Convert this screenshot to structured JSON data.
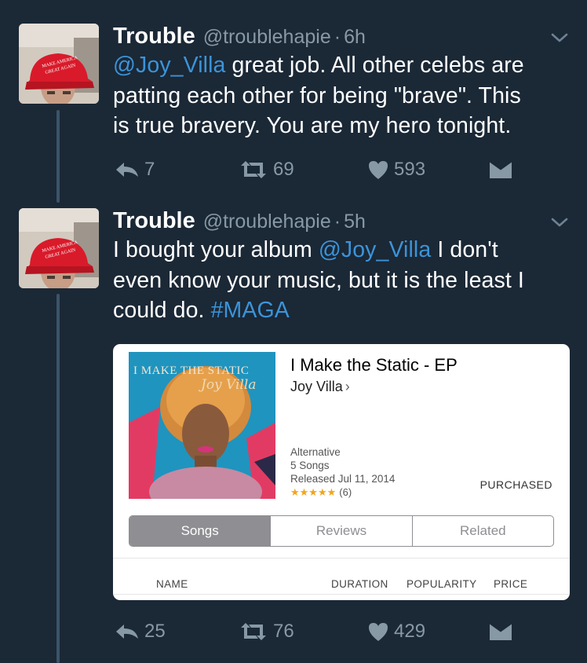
{
  "tweets": [
    {
      "name": "Trouble",
      "handle": "@troublehapie",
      "separator": "·",
      "time": "6h",
      "text_parts": {
        "mention": "@Joy_Villa",
        "line1_rest": " great job. All other celebs are",
        "line2": "patting each other for being \"brave\". This",
        "line3": "is true bravery. You are my hero tonight."
      },
      "replies": "7",
      "retweets": "69",
      "likes": "593"
    },
    {
      "name": "Trouble",
      "handle": "@troublehapie",
      "separator": "·",
      "time": "5h",
      "text_parts": {
        "line1_start": "I bought your album ",
        "mention": "@Joy_Villa",
        "line1_end": " I don't",
        "line2": "even know your music, but it is the least I",
        "line3_start": "could do. ",
        "hashtag": "#MAGA"
      },
      "replies": "25",
      "retweets": "76",
      "likes": "429"
    }
  ],
  "card": {
    "art_title": "I MAKE THE STATIC",
    "art_script": "Joy Villa",
    "album_title": "I Make the Static - EP",
    "artist": "Joy Villa",
    "artist_chevron": "›",
    "genre": "Alternative",
    "song_count": "5 Songs",
    "released": "Released Jul 11, 2014",
    "stars": "★★★★★",
    "rating_count": "(6)",
    "purchased": "PURCHASED",
    "tabs": [
      "Songs",
      "Reviews",
      "Related"
    ],
    "columns": {
      "name": "NAME",
      "duration": "DURATION",
      "popularity": "POPULARITY",
      "price": "PRICE"
    }
  },
  "colors": {
    "background": "#1b2836",
    "link": "#3b94d9",
    "muted": "#8899a6"
  },
  "icons": [
    "reply-icon",
    "retweet-icon",
    "like-icon",
    "direct-message-icon",
    "chevron-down-icon"
  ]
}
